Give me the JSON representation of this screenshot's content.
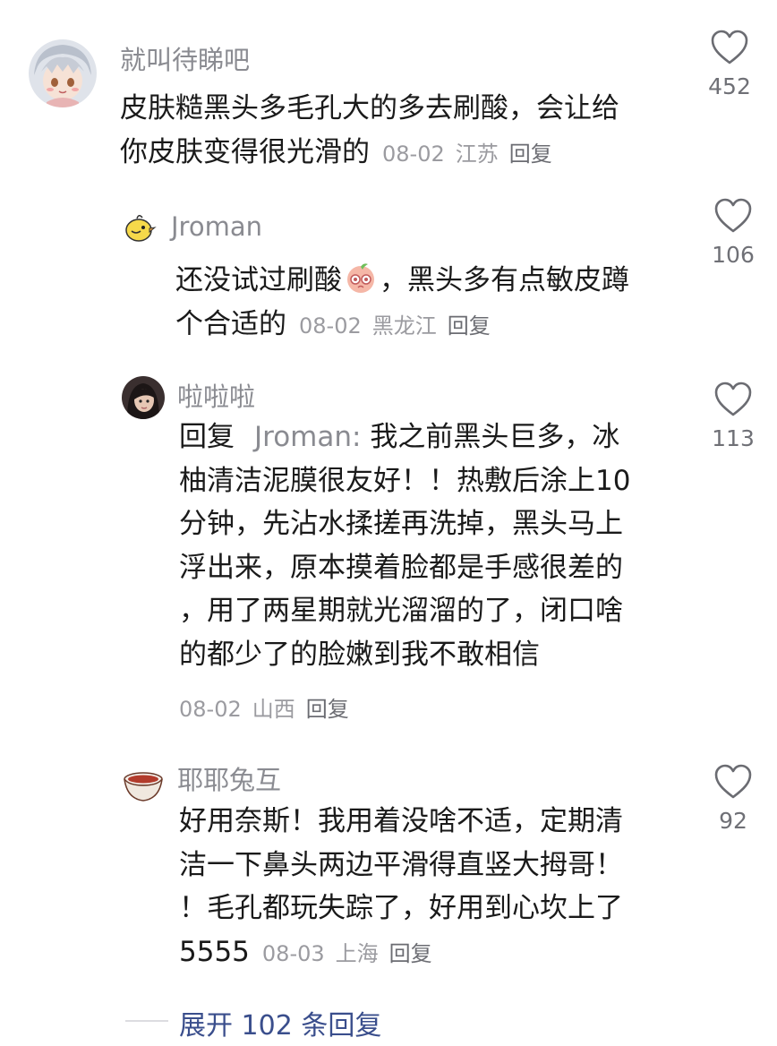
{
  "comments": [
    {
      "username": "就叫待睇吧",
      "lines": [
        "皮肤糙黑头多毛孔大的多去刷酸，会让给",
        "你皮肤变得很光滑的"
      ],
      "date": "08-02",
      "location": "江苏",
      "reply_label": "回复",
      "likes": "452",
      "avatar_icon": "anime-avatar-icon"
    },
    {
      "username": "Jroman",
      "line1_before": "还没试过刷酸",
      "line1_after": "，黑头多有点敏皮蹲",
      "line2": "个合适的",
      "date": "08-02",
      "location": "黑龙江",
      "reply_label": "回复",
      "likes": "106",
      "avatar_icon": "chick-avatar-icon",
      "emoji_icon": "peach-face-emoji-icon"
    },
    {
      "username": "啦啦啦",
      "reply_prefix": "回复",
      "reply_to": "Jroman",
      "line1_text": "我之前黑头巨多，冰",
      "lines": [
        "柚清洁泥膜很友好！！热敷后涂上10",
        "分钟，先沾水揉搓再洗掉，黑头马上",
        "浮出来，原本摸着脸都是手感很差的",
        "，用了两星期就光溜溜的了，闭口啥",
        "的都少了的脸嫩到我不敢相信"
      ],
      "date": "08-02",
      "location": "山西",
      "reply_label": "回复",
      "likes": "113",
      "avatar_icon": "girl-avatar-icon"
    },
    {
      "username": "耶耶兔互",
      "lines": [
        "好用奈斯！我用着没啥不适，定期清",
        "洁一下鼻头两边平滑得直竖大拇哥！",
        "！毛孔都玩失踪了，好用到心坎上了"
      ],
      "last_line_text": "5555",
      "date": "08-03",
      "location": "上海",
      "reply_label": "回复",
      "likes": "92",
      "avatar_icon": "bowl-avatar-icon"
    }
  ],
  "expand": {
    "label": "展开 102 条回复"
  },
  "colors": {
    "name": "#8a8b91",
    "text": "#1a1a1a",
    "meta": "#9b9ba0",
    "expand": "#3a4e8c"
  }
}
